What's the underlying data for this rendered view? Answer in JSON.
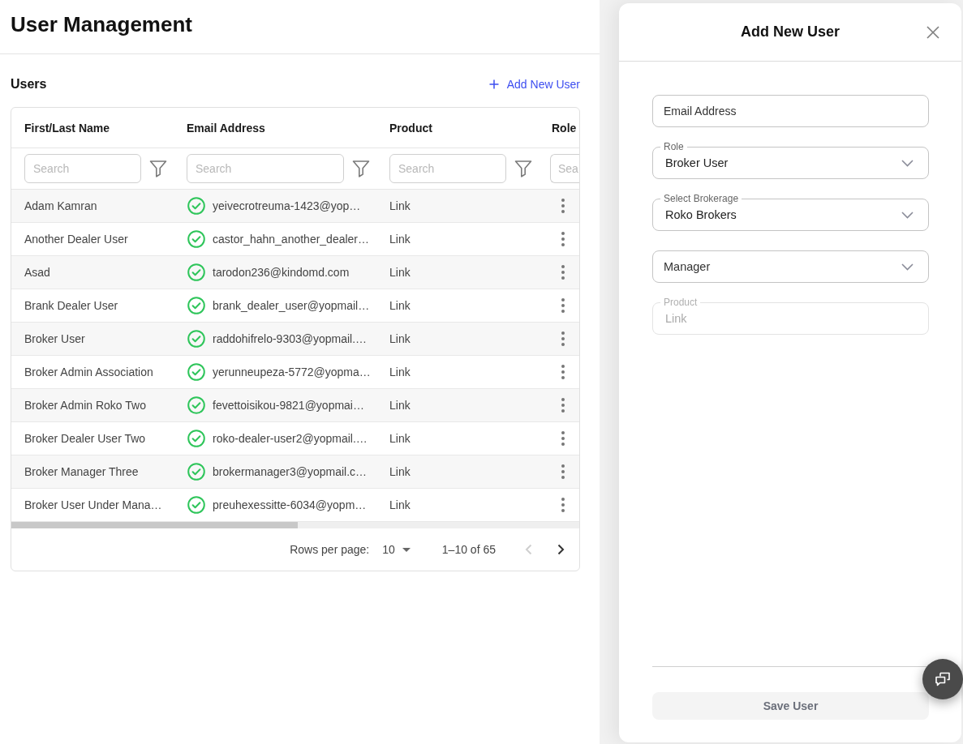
{
  "page": {
    "title": "User Management"
  },
  "users": {
    "title": "Users",
    "add_link": "Add New User",
    "table": {
      "columns": [
        {
          "label": "First/Last Name",
          "search_placeholder": "Search"
        },
        {
          "label": "Email Address",
          "search_placeholder": "Search"
        },
        {
          "label": "Product",
          "search_placeholder": "Search"
        },
        {
          "label": "Role",
          "search_placeholder": "Sea"
        }
      ],
      "rows": [
        {
          "name": "Adam Kamran",
          "verified": true,
          "email": "yeivecrotreuma-1423@yop…",
          "product": "Link"
        },
        {
          "name": "Another Dealer User",
          "verified": true,
          "email": "castor_hahn_another_dealer…",
          "product": "Link"
        },
        {
          "name": "Asad",
          "verified": true,
          "email": "tarodon236@kindomd.com",
          "product": "Link"
        },
        {
          "name": "Brank Dealer User",
          "verified": true,
          "email": "brank_dealer_user@yopmail…",
          "product": "Link"
        },
        {
          "name": "Broker User",
          "verified": true,
          "email": "raddohifrelo-9303@yopmail.…",
          "product": "Link"
        },
        {
          "name": "Broker Admin Association",
          "verified": true,
          "email": "yerunneupeza-5772@yopma…",
          "product": "Link"
        },
        {
          "name": "Broker Admin Roko Two",
          "verified": true,
          "email": "fevettoisikou-9821@yopmai…",
          "product": "Link"
        },
        {
          "name": "Broker Dealer User Two",
          "verified": true,
          "email": "roko-dealer-user2@yopmail.…",
          "product": "Link"
        },
        {
          "name": "Broker Manager Three",
          "verified": true,
          "email": "brokermanager3@yopmail.c…",
          "product": "Link"
        },
        {
          "name": "Broker User Under Mana…",
          "verified": true,
          "email": "preuhexessitte-6034@yopm…",
          "product": "Link"
        }
      ],
      "pagination": {
        "rows_per_page_label": "Rows per page:",
        "rows_per_page": "10",
        "range": "1–10 of 65",
        "previous": {
          "disabled": true
        },
        "next": {
          "disabled": false
        }
      }
    }
  },
  "drawer": {
    "title": "Add New User",
    "fields": [
      {
        "kind": "text",
        "placeholder": "Email Address",
        "disabled": false
      },
      {
        "kind": "select",
        "label": "Role",
        "value": "Broker User",
        "disabled": false
      },
      {
        "kind": "select",
        "label": "Select Brokerage",
        "value": "Roko Brokers",
        "disabled": false
      },
      {
        "kind": "select",
        "placeholder": "Manager",
        "disabled": false
      },
      {
        "kind": "text",
        "label": "Product",
        "value": "Link",
        "disabled": true
      }
    ],
    "save_button": {
      "label": "Save User",
      "disabled": true
    }
  }
}
